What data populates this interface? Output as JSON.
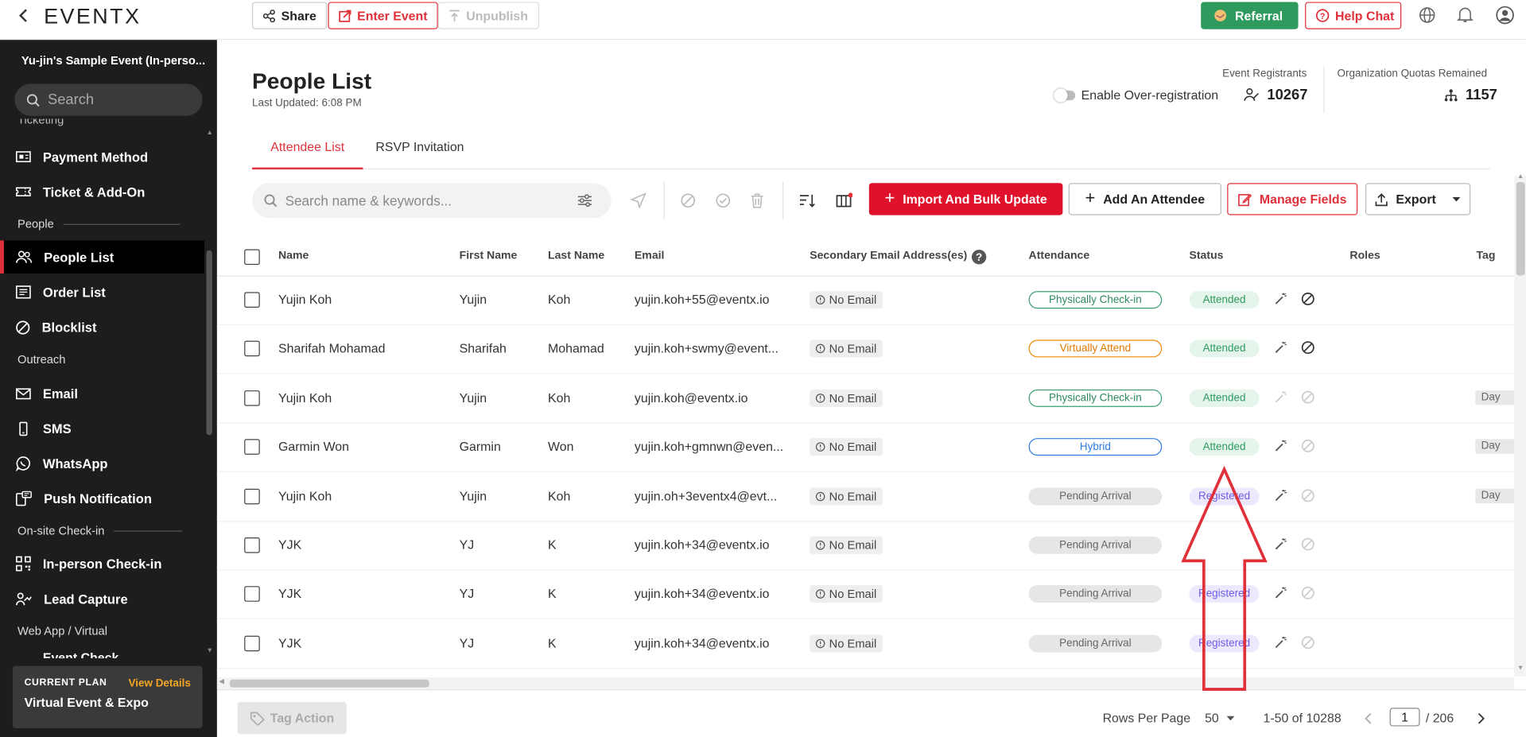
{
  "topbar": {
    "logo": "EVENTX",
    "share": "Share",
    "enter_event": "Enter Event",
    "unpublish": "Unpublish",
    "referral": "Referral",
    "help_chat": "Help Chat"
  },
  "sidebar": {
    "event_title": "Yu-jin's Sample Event (In-perso...",
    "search_placeholder": "Search",
    "cut_top": "Ticketing",
    "items_ticketing": [
      "Payment Method",
      "Ticket & Add-On"
    ],
    "section_people": "People",
    "items_people": [
      "People List",
      "Order List",
      "Blocklist"
    ],
    "section_outreach": "Outreach",
    "items_outreach": [
      "Email",
      "SMS",
      "WhatsApp",
      "Push Notification"
    ],
    "section_onsite": "On-site Check-in",
    "items_onsite": [
      "In-person Check-in",
      "Lead Capture"
    ],
    "section_web": "Web App / Virtual",
    "cut_bottom": "Event Check...",
    "plan": {
      "label": "CURRENT PLAN",
      "link": "View Details",
      "name": "Virtual Event & Expo"
    }
  },
  "header": {
    "title": "People List",
    "updated": "Last Updated: 6:08 PM",
    "registrants_label": "Event Registrants",
    "over_reg": "Enable Over-registration",
    "registrants": "10267",
    "quota_label": "Organization Quotas Remained",
    "quota": "1157"
  },
  "tabs": [
    "Attendee List",
    "RSVP Invitation"
  ],
  "toolbar": {
    "search_placeholder": "Search name & keywords...",
    "import": "Import And Bulk Update",
    "add": "Add An Attendee",
    "manage": "Manage Fields",
    "export": "Export"
  },
  "columns": [
    "Name",
    "First Name",
    "Last Name",
    "Email",
    "Secondary Email Address(es)",
    "Attendance",
    "Status",
    "Roles",
    "Tag"
  ],
  "no_email": "No Email",
  "rows": [
    {
      "name": "Yujin Koh",
      "first": "Yujin",
      "last": "Koh",
      "email": "yujin.koh+55@eventx.io",
      "attendance": "Physically Check-in",
      "att_style": "green",
      "status": "Attended",
      "st_style": "green",
      "tag": ""
    },
    {
      "name": "Sharifah Mohamad",
      "first": "Sharifah",
      "last": "Mohamad",
      "email": "yujin.koh+swmy@event...",
      "attendance": "Virtually Attend",
      "att_style": "orange",
      "status": "Attended",
      "st_style": "green",
      "tag": ""
    },
    {
      "name": "Yujin Koh",
      "first": "Yujin",
      "last": "Koh",
      "email": "yujin.koh@eventx.io",
      "attendance": "Physically Check-in",
      "att_style": "green",
      "status": "Attended",
      "st_style": "green",
      "tag": "Day"
    },
    {
      "name": "Garmin Won",
      "first": "Garmin",
      "last": "Won",
      "email": "yujin.koh+gmnwn@even...",
      "attendance": "Hybrid",
      "att_style": "blue",
      "status": "Attended",
      "st_style": "green",
      "tag": "Day"
    },
    {
      "name": "Yujin Koh",
      "first": "Yujin",
      "last": "Koh",
      "email": "yujin.oh+3eventx4@evt...",
      "attendance": "Pending Arrival",
      "att_style": "grey",
      "status": "Registered",
      "st_style": "purple",
      "tag": "Day"
    },
    {
      "name": "YJK",
      "first": "YJ",
      "last": "K",
      "email": "yujin.koh+34@eventx.io",
      "attendance": "Pending Arrival",
      "att_style": "grey",
      "status": "",
      "st_style": "none",
      "tag": ""
    },
    {
      "name": "YJK",
      "first": "YJ",
      "last": "K",
      "email": "yujin.koh+34@eventx.io",
      "attendance": "Pending Arrival",
      "att_style": "grey",
      "status": "Registered",
      "st_style": "purple",
      "tag": ""
    },
    {
      "name": "YJK",
      "first": "YJ",
      "last": "K",
      "email": "yujin.koh+34@eventx.io",
      "attendance": "Pending Arrival",
      "att_style": "grey",
      "status": "Registered",
      "st_style": "purple",
      "tag": ""
    }
  ],
  "footer": {
    "tag_action": "Tag Action",
    "rows_per_page_label": "Rows Per Page",
    "rows_per_page": "50",
    "range": "1-50 of 10288",
    "page": "1",
    "pages": "/ 206"
  },
  "colors": {
    "brand_red": "#e0303a",
    "green": "#2e9a5e",
    "sidebar": "#1d1d1d",
    "annotation_arrow": "#e0303a"
  }
}
